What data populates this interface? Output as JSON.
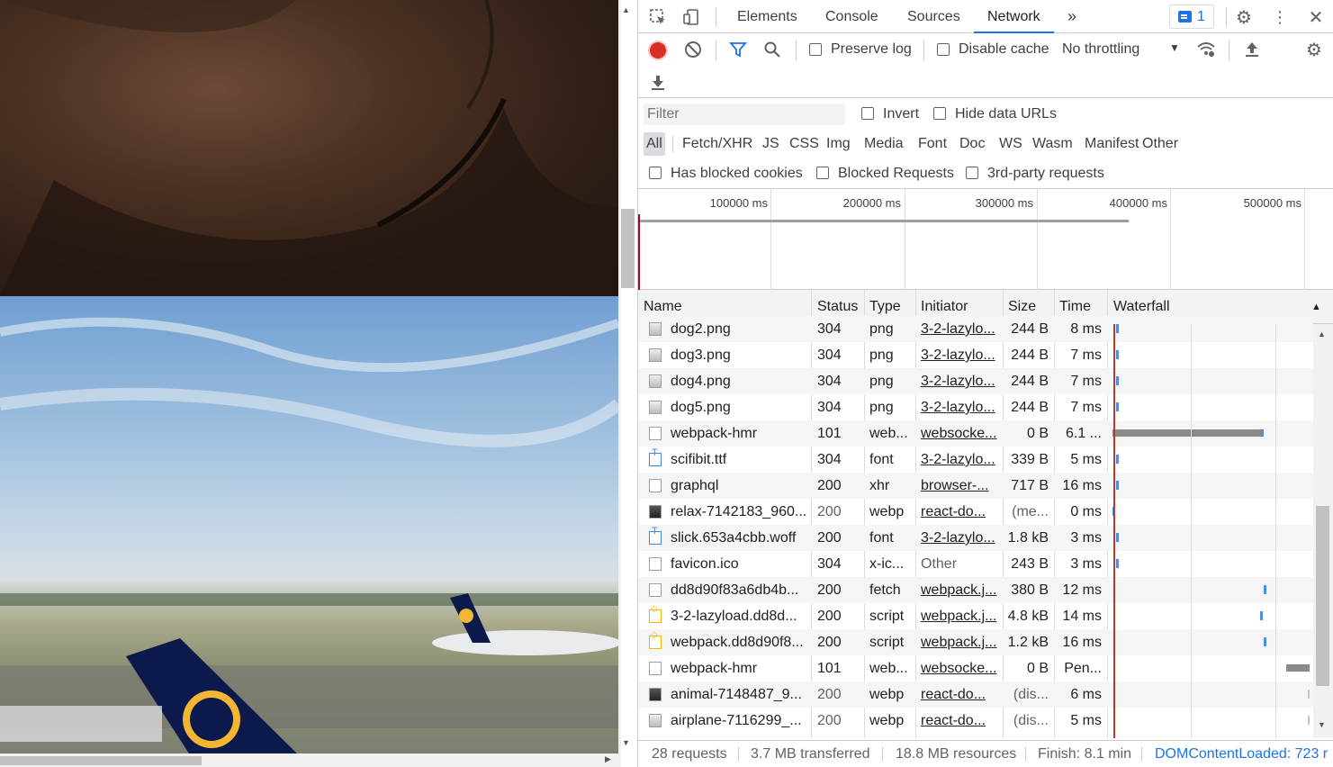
{
  "devtools": {
    "tabs": [
      "Elements",
      "Console",
      "Sources",
      "Network"
    ],
    "active_tab": "Network",
    "more_tabs": "»",
    "issues_count": "1"
  },
  "toolbar": {
    "preserve_log": "Preserve log",
    "disable_cache": "Disable cache",
    "throttling": "No throttling"
  },
  "filter": {
    "placeholder": "Filter",
    "invert": "Invert",
    "hide_data_urls": "Hide data URLs",
    "types": [
      "All",
      "Fetch/XHR",
      "JS",
      "CSS",
      "Img",
      "Media",
      "Font",
      "Doc",
      "WS",
      "Wasm",
      "Manifest",
      "Other"
    ],
    "selected_type": "All",
    "has_blocked_cookies": "Has blocked cookies",
    "blocked_requests": "Blocked Requests",
    "third_party": "3rd-party requests"
  },
  "overview": {
    "ticks": [
      "100000 ms",
      "200000 ms",
      "300000 ms",
      "400000 ms",
      "500000 ms"
    ]
  },
  "grid": {
    "columns": [
      "Name",
      "Status",
      "Type",
      "Initiator",
      "Size",
      "Time",
      "Waterfall"
    ],
    "rows": [
      {
        "name": "dog2.png",
        "status": "304",
        "type": "png",
        "initiator": "3-2-lazylo...",
        "size": "244 B",
        "time": "8 ms",
        "icon": "image-file-icon"
      },
      {
        "name": "dog3.png",
        "status": "304",
        "type": "png",
        "initiator": "3-2-lazylo...",
        "size": "244 B",
        "time": "7 ms",
        "icon": "image-file-icon"
      },
      {
        "name": "dog4.png",
        "status": "304",
        "type": "png",
        "initiator": "3-2-lazylo...",
        "size": "244 B",
        "time": "7 ms",
        "icon": "image-file-icon"
      },
      {
        "name": "dog5.png",
        "status": "304",
        "type": "png",
        "initiator": "3-2-lazylo...",
        "size": "244 B",
        "time": "7 ms",
        "icon": "image-file-icon"
      },
      {
        "name": "webpack-hmr",
        "status": "101",
        "type": "web...",
        "initiator": "websocke...",
        "size": "0 B",
        "time": "6.1 ...",
        "icon": "document-file-icon"
      },
      {
        "name": "scifibit.ttf",
        "status": "304",
        "type": "font",
        "initiator": "3-2-lazylo...",
        "size": "339 B",
        "time": "5 ms",
        "icon": "font-file-icon"
      },
      {
        "name": "graphql",
        "status": "200",
        "type": "xhr",
        "initiator": "browser-...",
        "size": "717 B",
        "time": "16 ms",
        "icon": "document-file-icon"
      },
      {
        "name": "relax-7142183_960...",
        "status": "200",
        "type": "webp",
        "initiator": "react-do...",
        "size": "(me...",
        "time": "0 ms",
        "icon": "image-file-icon"
      },
      {
        "name": "slick.653a4cbb.woff",
        "status": "200",
        "type": "font",
        "initiator": "3-2-lazylo...",
        "size": "1.8 kB",
        "time": "3 ms",
        "icon": "font-file-icon"
      },
      {
        "name": "favicon.ico",
        "status": "304",
        "type": "x-ic...",
        "initiator": "Other",
        "size": "243 B",
        "time": "3 ms",
        "icon": "document-file-icon"
      },
      {
        "name": "dd8d90f83a6db4b...",
        "status": "200",
        "type": "fetch",
        "initiator": "webpack.j...",
        "size": "380 B",
        "time": "12 ms",
        "icon": "document-file-icon"
      },
      {
        "name": "3-2-lazyload.dd8d...",
        "status": "200",
        "type": "script",
        "initiator": "webpack.j...",
        "size": "4.8 kB",
        "time": "14 ms",
        "icon": "script-file-icon"
      },
      {
        "name": "webpack.dd8d90f8...",
        "status": "200",
        "type": "script",
        "initiator": "webpack.j...",
        "size": "1.2 kB",
        "time": "16 ms",
        "icon": "script-file-icon"
      },
      {
        "name": "webpack-hmr",
        "status": "101",
        "type": "web...",
        "initiator": "websocke...",
        "size": "0 B",
        "time": "Pen...",
        "icon": "document-file-icon"
      },
      {
        "name": "animal-7148487_9...",
        "status": "200",
        "type": "webp",
        "initiator": "react-do...",
        "size": "(dis...",
        "time": "6 ms",
        "icon": "image-file-icon"
      },
      {
        "name": "airplane-7116299_...",
        "status": "200",
        "type": "webp",
        "initiator": "react-do...",
        "size": "(dis...",
        "time": "5 ms",
        "icon": "image-file-icon"
      }
    ]
  },
  "status": {
    "requests": "28 requests",
    "transferred": "3.7 MB transferred",
    "resources": "18.8 MB resources",
    "finish": "Finish: 8.1 min",
    "dom_content_loaded": "DOMContentLoaded: 723 r"
  },
  "colors": {
    "accent": "#1a73e8",
    "record": "#d93025",
    "waterfall_bar": "#4a8fe7"
  }
}
